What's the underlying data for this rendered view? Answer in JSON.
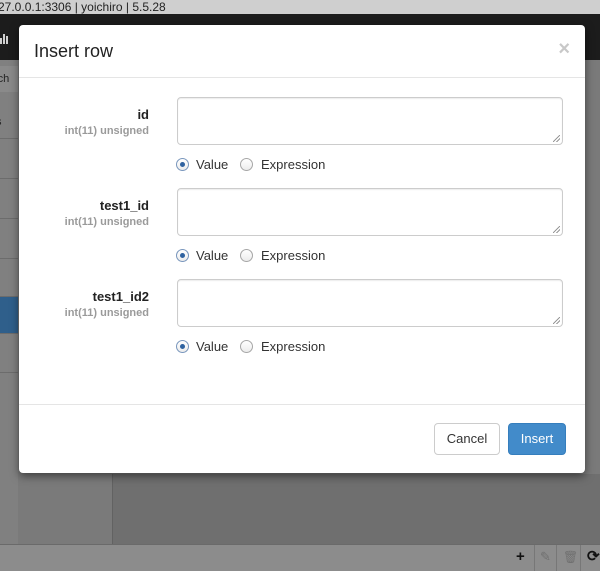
{
  "background": {
    "title_text": "27.0.0.1:3306 | yoichiro | 5.5.28",
    "search_fragment": "rch",
    "side_label_fragment": "s"
  },
  "dialog": {
    "title": "Insert row",
    "close_symbol": "×",
    "fields": [
      {
        "name": "id",
        "type": "int(11) unsigned",
        "value": "",
        "mode_options": [
          "Value",
          "Expression"
        ],
        "selected_mode": "Value"
      },
      {
        "name": "test1_id",
        "type": "int(11) unsigned",
        "value": "",
        "mode_options": [
          "Value",
          "Expression"
        ],
        "selected_mode": "Value"
      },
      {
        "name": "test1_id2",
        "type": "int(11) unsigned",
        "value": "",
        "mode_options": [
          "Value",
          "Expression"
        ],
        "selected_mode": "Value"
      }
    ],
    "buttons": {
      "cancel": "Cancel",
      "insert": "Insert"
    }
  },
  "bottom_toolbar": {
    "add_symbol": "+",
    "refresh_symbol": "⟳"
  },
  "colors": {
    "primary": "#428bca",
    "radio_checked": "#2f62a0",
    "toolbar_dark": "#1c1c1c"
  }
}
